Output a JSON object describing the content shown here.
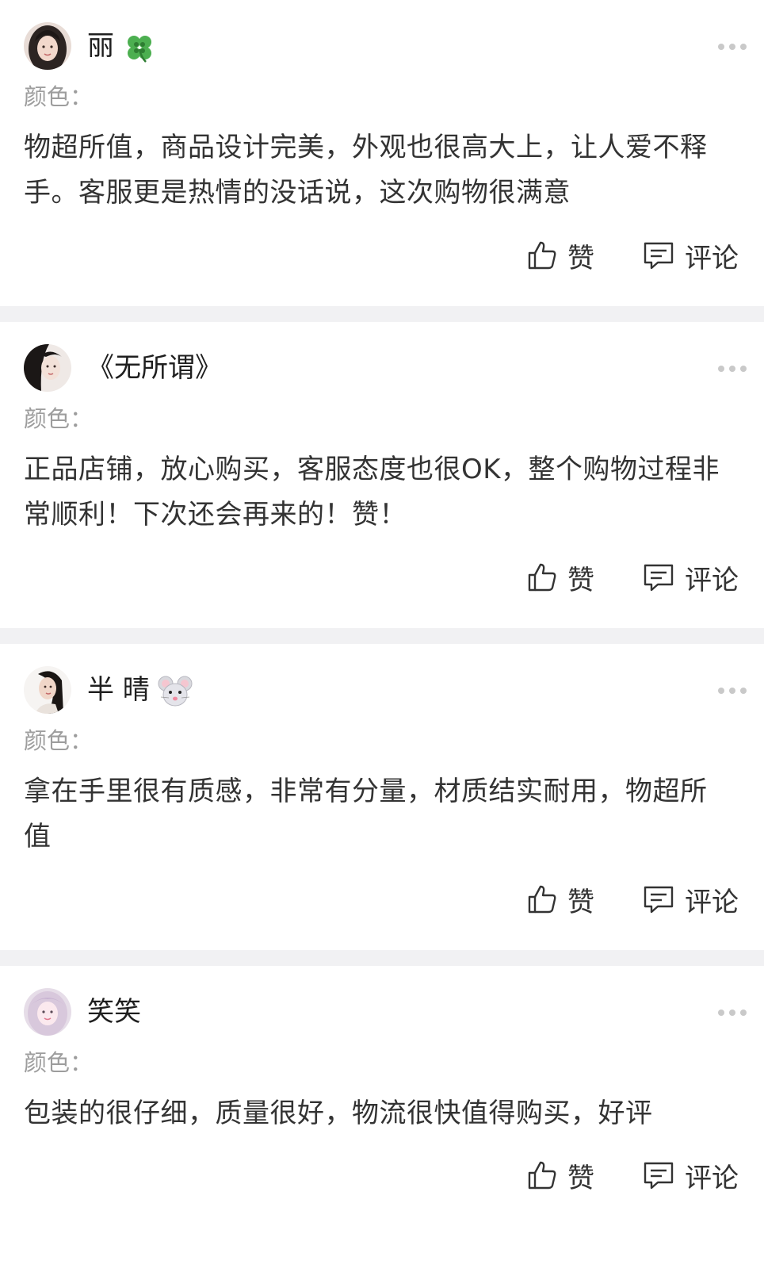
{
  "reviews": [
    {
      "username": "丽",
      "name_emoji": "four-leaf-clover",
      "color_label": "颜色：",
      "content": "物超所值，商品设计完美，外观也很高大上，让人爱不释手。客服更是热情的没话说，这次购物很满意",
      "like_label": "赞",
      "comment_label": "评论"
    },
    {
      "username": "《无所谓》",
      "name_emoji": "",
      "color_label": "颜色：",
      "content": "正品店铺，放心购买，客服态度也很OK，整个购物过程非常顺利！下次还会再来的！赞！",
      "like_label": "赞",
      "comment_label": "评论"
    },
    {
      "username": "半 晴",
      "name_emoji": "mouse-face",
      "color_label": "颜色：",
      "content": "拿在手里很有质感，非常有分量，材质结实耐用，物超所值",
      "like_label": "赞",
      "comment_label": "评论"
    },
    {
      "username": "笑笑",
      "name_emoji": "",
      "color_label": "颜色：",
      "content": "包装的很仔细，质量很好，物流很快值得购买，好评",
      "like_label": "赞",
      "comment_label": "评论"
    }
  ],
  "colors": {
    "separator": "#f1f1f3",
    "muted_text": "#9d9d9d",
    "body_text": "#333333",
    "more_dots": "#c9c9c9"
  },
  "icons": {
    "like": "thumbs-up-icon",
    "comment": "comment-icon",
    "more": "more-dots-icon"
  }
}
